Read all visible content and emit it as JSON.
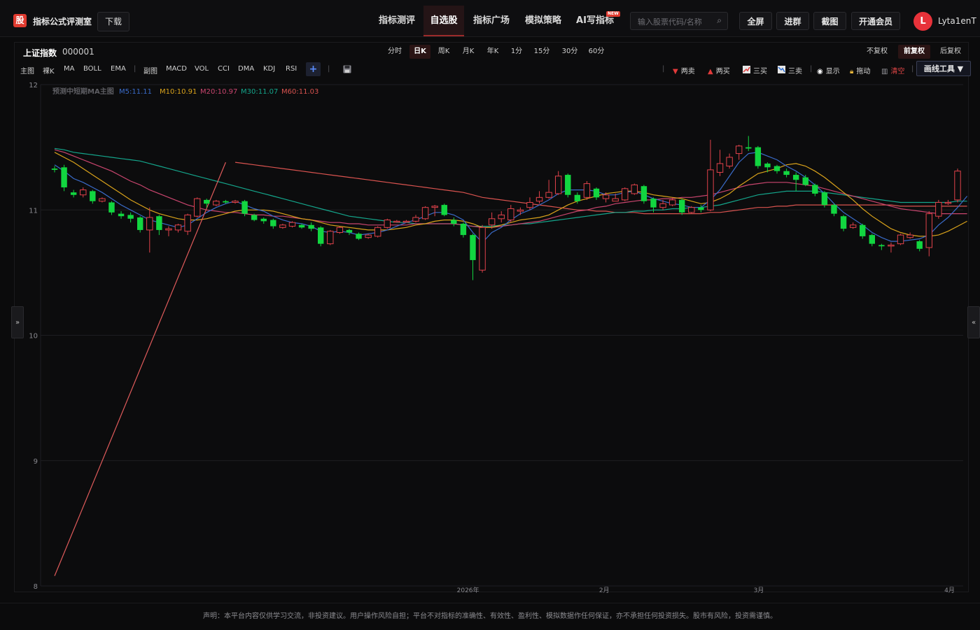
{
  "app": {
    "logo_glyph": "股",
    "title": "指标公式评测室",
    "download_label": "下载"
  },
  "nav": {
    "items": [
      {
        "label": "指标测评"
      },
      {
        "label": "自选股",
        "active": true
      },
      {
        "label": "指标广场"
      },
      {
        "label": "模拟策略"
      },
      {
        "label": "AI写指标",
        "badge": "NEW"
      }
    ]
  },
  "search": {
    "placeholder": "输入股票代码/名称",
    "value": ""
  },
  "top_buttons": {
    "fullscreen": "全屏",
    "join_group": "进群",
    "screenshot": "截图",
    "vip": "开通会员"
  },
  "user": {
    "initial": "L",
    "name": "Lyta1enT"
  },
  "stock": {
    "name": "上证指数",
    "code": "000001"
  },
  "periods": [
    "分时",
    "日K",
    "周K",
    "月K",
    "年K",
    "1分",
    "15分",
    "30分",
    "60分"
  ],
  "active_period": "日K",
  "adjust": {
    "items": [
      "不复权",
      "前复权",
      "后复权"
    ],
    "active": "前复权"
  },
  "indicator_bar": {
    "main_label": "主图",
    "main_items": [
      "裸K",
      "MA",
      "BOLL",
      "EMA"
    ],
    "sub_label": "副图",
    "sub_items": [
      "MACD",
      "VOL",
      "CCI",
      "DMA",
      "KDJ",
      "RSI"
    ],
    "add_label": "+"
  },
  "tools": {
    "two_sell": "两卖",
    "two_buy": "两买",
    "three_buy": "三买",
    "three_sell": "三卖",
    "show": "显示",
    "drag": "拖动",
    "clear": "清空",
    "draw_tools": "画线工具 ▼"
  },
  "colors": {
    "up": "#e0424b",
    "down": "#12d640",
    "ma5": "#3a6bc9",
    "ma10": "#d9a21b",
    "ma20": "#c9456e",
    "ma30": "#14a58b",
    "ma60": "#d9534f",
    "predict": "#e05b5b"
  },
  "chart_data": {
    "type": "candlestick",
    "ylim": [
      8,
      12
    ],
    "yticks": [
      8,
      9,
      10,
      11,
      12
    ],
    "x_ticks": [
      "2026年",
      "2月",
      "3月",
      "4月"
    ],
    "legend": [
      {
        "key": "predict",
        "label": "预测中短期MA主图"
      },
      {
        "key": "ma5",
        "label": "M5:11.11"
      },
      {
        "key": "ma10",
        "label": "M10:10.91"
      },
      {
        "key": "ma20",
        "label": "M20:10.97"
      },
      {
        "key": "ma30",
        "label": "M30:11.07"
      },
      {
        "key": "ma60",
        "label": "M60:11.03"
      }
    ],
    "candles": [
      [
        11.33,
        11.32,
        11.35,
        11.3
      ],
      [
        11.34,
        11.18,
        11.36,
        11.15
      ],
      [
        11.14,
        11.12,
        11.16,
        11.1
      ],
      [
        11.12,
        11.16,
        11.18,
        11.1
      ],
      [
        11.15,
        11.07,
        11.16,
        11.05
      ],
      [
        11.07,
        11.09,
        11.1,
        11.06
      ],
      [
        11.06,
        10.98,
        11.07,
        10.96
      ],
      [
        10.97,
        10.95,
        10.99,
        10.93
      ],
      [
        10.96,
        10.93,
        10.98,
        10.9
      ],
      [
        10.94,
        10.84,
        10.95,
        10.82
      ],
      [
        10.84,
        10.94,
        11.02,
        10.66
      ],
      [
        10.95,
        10.84,
        10.96,
        10.8
      ],
      [
        10.84,
        10.85,
        10.87,
        10.79
      ],
      [
        10.84,
        10.88,
        10.89,
        10.82
      ],
      [
        10.83,
        10.96,
        10.97,
        10.8
      ],
      [
        10.95,
        11.09,
        11.1,
        10.94
      ],
      [
        11.08,
        11.05,
        11.09,
        11.02
      ],
      [
        11.04,
        11.07,
        11.08,
        11.03
      ],
      [
        11.07,
        11.06,
        11.08,
        11.05
      ],
      [
        11.06,
        11.07,
        11.08,
        11.05
      ],
      [
        11.07,
        10.97,
        11.08,
        10.95
      ],
      [
        10.96,
        10.92,
        10.97,
        10.91
      ],
      [
        10.93,
        10.91,
        10.94,
        10.89
      ],
      [
        10.92,
        10.87,
        10.93,
        10.85
      ],
      [
        10.86,
        10.88,
        10.89,
        10.85
      ],
      [
        10.87,
        10.9,
        10.91,
        10.86
      ],
      [
        10.88,
        10.86,
        10.89,
        10.85
      ],
      [
        10.88,
        10.85,
        10.9,
        10.83
      ],
      [
        10.86,
        10.73,
        10.87,
        10.71
      ],
      [
        10.73,
        10.83,
        10.84,
        10.72
      ],
      [
        10.82,
        10.86,
        10.87,
        10.81
      ],
      [
        10.84,
        10.82,
        10.85,
        10.8
      ],
      [
        10.81,
        10.77,
        10.82,
        10.76
      ],
      [
        10.78,
        10.8,
        10.81,
        10.77
      ],
      [
        10.79,
        10.86,
        10.87,
        10.78
      ],
      [
        10.86,
        10.92,
        10.93,
        10.85
      ],
      [
        10.91,
        10.91,
        10.92,
        10.9
      ],
      [
        10.91,
        10.91,
        10.92,
        10.9
      ],
      [
        10.91,
        10.94,
        10.96,
        10.9
      ],
      [
        10.93,
        11.02,
        11.03,
        10.92
      ],
      [
        11.02,
        11.03,
        11.04,
        10.95
      ],
      [
        11.04,
        10.96,
        11.05,
        10.95
      ],
      [
        10.92,
        10.89,
        10.94,
        10.87
      ],
      [
        10.89,
        10.8,
        10.9,
        10.78
      ],
      [
        10.8,
        10.6,
        10.81,
        10.44
      ],
      [
        10.52,
        10.86,
        10.88,
        10.5
      ],
      [
        10.88,
        10.93,
        10.98,
        10.85
      ],
      [
        10.93,
        10.96,
        10.99,
        10.9
      ],
      [
        10.92,
        11.01,
        11.04,
        10.9
      ],
      [
        10.99,
        11.0,
        11.02,
        10.96
      ],
      [
        11.02,
        11.06,
        11.1,
        11.0
      ],
      [
        11.07,
        11.1,
        11.15,
        11.05
      ],
      [
        11.1,
        11.14,
        11.24,
        11.09
      ],
      [
        11.13,
        11.27,
        11.31,
        11.12
      ],
      [
        11.28,
        11.12,
        11.29,
        11.1
      ],
      [
        11.12,
        11.07,
        11.14,
        11.05
      ],
      [
        11.1,
        11.21,
        11.23,
        11.08
      ],
      [
        11.17,
        11.1,
        11.18,
        11.08
      ],
      [
        11.09,
        11.12,
        11.14,
        11.06
      ],
      [
        11.07,
        11.09,
        11.13,
        11.07
      ],
      [
        11.08,
        11.17,
        11.18,
        11.07
      ],
      [
        11.13,
        11.2,
        11.21,
        11.12
      ],
      [
        11.19,
        11.07,
        11.2,
        11.05
      ],
      [
        11.09,
        11.02,
        11.1,
        10.98
      ],
      [
        11.02,
        11.05,
        11.08,
        11.0
      ],
      [
        11.04,
        11.08,
        11.1,
        11.03
      ],
      [
        11.08,
        10.98,
        11.09,
        10.96
      ],
      [
        10.98,
        11.02,
        11.03,
        10.97
      ],
      [
        11.02,
        11.0,
        11.04,
        10.98
      ],
      [
        11.0,
        11.32,
        11.56,
        10.99
      ],
      [
        11.3,
        11.37,
        11.48,
        11.27
      ],
      [
        11.35,
        11.42,
        11.45,
        11.33
      ],
      [
        11.45,
        11.51,
        11.52,
        11.4
      ],
      [
        11.5,
        11.49,
        11.59,
        11.47
      ],
      [
        11.5,
        11.35,
        11.51,
        11.33
      ],
      [
        11.37,
        11.34,
        11.38,
        11.3
      ],
      [
        11.35,
        11.31,
        11.36,
        11.29
      ],
      [
        11.31,
        11.28,
        11.33,
        11.26
      ],
      [
        11.28,
        11.24,
        11.3,
        11.15
      ],
      [
        11.26,
        11.2,
        11.28,
        11.19
      ],
      [
        11.2,
        11.13,
        11.21,
        11.11
      ],
      [
        11.14,
        11.04,
        11.15,
        11.02
      ],
      [
        11.04,
        10.97,
        11.05,
        10.95
      ],
      [
        10.95,
        10.85,
        10.96,
        10.83
      ],
      [
        10.86,
        10.88,
        10.9,
        10.85
      ],
      [
        10.88,
        10.79,
        10.89,
        10.77
      ],
      [
        10.8,
        10.73,
        10.81,
        10.71
      ],
      [
        10.72,
        10.71,
        10.73,
        10.68
      ],
      [
        10.72,
        10.72,
        10.74,
        10.66
      ],
      [
        10.73,
        10.8,
        10.81,
        10.72
      ],
      [
        10.78,
        10.8,
        10.82,
        10.77
      ],
      [
        10.75,
        10.69,
        10.76,
        10.67
      ],
      [
        10.7,
        10.97,
        10.99,
        10.63
      ],
      [
        10.95,
        11.06,
        11.08,
        10.93
      ],
      [
        11.06,
        11.06,
        11.08,
        11.04
      ],
      [
        11.08,
        11.31,
        11.33,
        11.06
      ]
    ],
    "ma5": [
      11.36,
      11.31,
      11.25,
      11.22,
      11.18,
      11.14,
      11.09,
      11.04,
      11.0,
      10.96,
      10.92,
      10.9,
      10.88,
      10.86,
      10.88,
      10.93,
      10.98,
      11.02,
      11.05,
      11.07,
      11.04,
      11.01,
      10.99,
      10.95,
      10.92,
      10.9,
      10.89,
      10.87,
      10.83,
      10.82,
      10.83,
      10.82,
      10.8,
      10.81,
      10.82,
      10.84,
      10.87,
      10.9,
      10.92,
      10.95,
      10.98,
      10.98,
      10.96,
      10.92,
      10.82,
      10.74,
      10.82,
      10.86,
      10.92,
      10.97,
      11.0,
      11.04,
      11.08,
      11.13,
      11.16,
      11.16,
      11.16,
      11.15,
      11.12,
      11.12,
      11.14,
      11.15,
      11.12,
      11.09,
      11.07,
      11.05,
      11.04,
      11.02,
      11.02,
      11.08,
      11.16,
      11.27,
      11.38,
      11.45,
      11.46,
      11.43,
      11.4,
      11.35,
      11.31,
      11.26,
      11.2,
      11.13,
      11.05,
      10.98,
      10.93,
      10.88,
      10.82,
      10.78,
      10.75,
      10.75,
      10.76,
      10.77,
      10.8,
      10.88,
      10.94,
      11.02,
      11.11
    ],
    "ma10": [
      11.46,
      11.42,
      11.38,
      11.33,
      11.28,
      11.23,
      11.18,
      11.13,
      11.08,
      11.04,
      11.0,
      10.97,
      10.95,
      10.93,
      10.92,
      10.92,
      10.93,
      10.95,
      10.97,
      10.99,
      11.0,
      11.0,
      11.0,
      10.99,
      10.97,
      10.95,
      10.93,
      10.92,
      10.9,
      10.88,
      10.87,
      10.86,
      10.85,
      10.84,
      10.84,
      10.84,
      10.85,
      10.86,
      10.88,
      10.89,
      10.91,
      10.92,
      10.92,
      10.91,
      10.89,
      10.86,
      10.86,
      10.88,
      10.9,
      10.92,
      10.93,
      10.94,
      10.96,
      11.0,
      11.04,
      11.07,
      11.09,
      11.11,
      11.13,
      11.14,
      11.15,
      11.15,
      11.14,
      11.12,
      11.11,
      11.1,
      11.09,
      11.07,
      11.05,
      11.06,
      11.09,
      11.13,
      11.19,
      11.24,
      11.29,
      11.31,
      11.33,
      11.36,
      11.37,
      11.35,
      11.31,
      11.26,
      11.2,
      11.14,
      11.08,
      11.01,
      10.95,
      10.9,
      10.85,
      10.82,
      10.8,
      10.79,
      10.79,
      10.8,
      10.83,
      10.87,
      10.91
    ],
    "ma20": [
      11.48,
      11.46,
      11.43,
      11.4,
      11.37,
      11.34,
      11.31,
      11.27,
      11.23,
      11.2,
      11.16,
      11.13,
      11.1,
      11.07,
      11.04,
      11.02,
      11.0,
      10.99,
      10.98,
      10.98,
      10.97,
      10.96,
      10.96,
      10.95,
      10.95,
      10.94,
      10.93,
      10.92,
      10.91,
      10.9,
      10.9,
      10.89,
      10.89,
      10.88,
      10.88,
      10.88,
      10.88,
      10.88,
      10.89,
      10.89,
      10.89,
      10.89,
      10.89,
      10.88,
      10.87,
      10.86,
      10.86,
      10.87,
      10.88,
      10.89,
      10.9,
      10.91,
      10.93,
      10.95,
      10.97,
      10.99,
      11.0,
      11.02,
      11.03,
      11.05,
      11.06,
      11.07,
      11.08,
      11.08,
      11.09,
      11.09,
      11.1,
      11.1,
      11.11,
      11.12,
      11.14,
      11.16,
      11.18,
      11.2,
      11.21,
      11.22,
      11.22,
      11.22,
      11.21,
      11.2,
      11.19,
      11.17,
      11.15,
      11.13,
      11.11,
      11.09,
      11.07,
      11.05,
      11.03,
      11.01,
      11.0,
      10.99,
      10.98,
      10.97,
      10.97,
      10.97,
      10.97
    ],
    "ma30": [
      11.49,
      11.48,
      11.46,
      11.45,
      11.44,
      11.43,
      11.42,
      11.41,
      11.4,
      11.39,
      11.37,
      11.35,
      11.33,
      11.31,
      11.29,
      11.27,
      11.25,
      11.23,
      11.21,
      11.19,
      11.17,
      11.15,
      11.13,
      11.11,
      11.09,
      11.07,
      11.05,
      11.03,
      11.01,
      10.99,
      10.97,
      10.95,
      10.94,
      10.93,
      10.92,
      10.91,
      10.9,
      10.9,
      10.89,
      10.89,
      10.89,
      10.89,
      10.89,
      10.88,
      10.87,
      10.87,
      10.87,
      10.88,
      10.88,
      10.89,
      10.89,
      10.9,
      10.91,
      10.92,
      10.93,
      10.94,
      10.95,
      10.96,
      10.97,
      10.98,
      10.98,
      10.99,
      10.99,
      11.0,
      11.0,
      11.01,
      11.01,
      11.02,
      11.02,
      11.03,
      11.04,
      11.06,
      11.08,
      11.1,
      11.12,
      11.13,
      11.14,
      11.15,
      11.15,
      11.15,
      11.15,
      11.14,
      11.13,
      11.12,
      11.11,
      11.1,
      11.09,
      11.08,
      11.07,
      11.06,
      11.06,
      11.06,
      11.06,
      11.06,
      11.06,
      11.07,
      11.07
    ],
    "ma60": [
      null,
      null,
      null,
      null,
      null,
      null,
      null,
      null,
      null,
      null,
      null,
      null,
      null,
      null,
      null,
      null,
      null,
      null,
      null,
      11.38,
      11.37,
      11.36,
      11.35,
      11.34,
      11.33,
      11.32,
      11.31,
      11.3,
      11.29,
      11.28,
      11.27,
      11.26,
      11.25,
      11.24,
      11.23,
      11.22,
      11.21,
      11.2,
      11.19,
      11.18,
      11.17,
      11.16,
      11.15,
      11.14,
      11.12,
      11.1,
      11.09,
      11.08,
      11.07,
      11.06,
      11.05,
      11.04,
      11.03,
      11.02,
      11.01,
      11.0,
      11.0,
      10.99,
      10.99,
      10.98,
      10.98,
      10.98,
      10.97,
      10.97,
      10.97,
      10.97,
      10.97,
      10.97,
      10.97,
      10.98,
      10.98,
      10.99,
      11.0,
      11.01,
      11.02,
      11.02,
      11.03,
      11.03,
      11.04,
      11.04,
      11.04,
      11.04,
      11.04,
      11.04,
      11.04,
      11.04,
      11.04,
      11.04,
      11.04,
      11.03,
      11.03,
      11.03,
      11.03,
      11.03,
      11.03,
      11.03,
      11.03
    ],
    "predict_line": {
      "start": [
        0,
        8.08
      ],
      "end": [
        18,
        11.38
      ]
    }
  },
  "disclaimer": "声明：本平台内容仅供学习交流，非投资建议。用户操作风险自担；平台不对指标的准确性、有效性、盈利性、模拟数据作任何保证，亦不承担任何投资损失。股市有风险，投资需谨慎。"
}
